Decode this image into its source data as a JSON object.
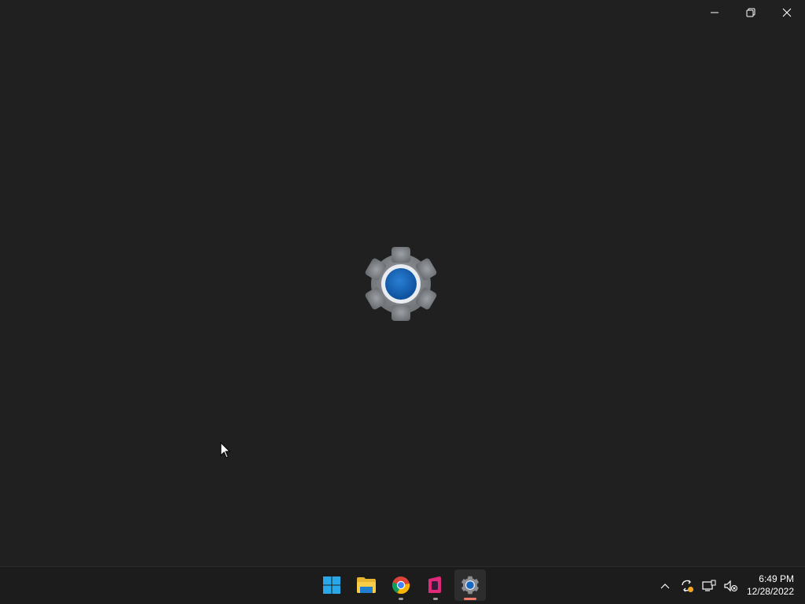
{
  "window": {
    "controls": {
      "minimize_icon": "minimize-icon",
      "restore_icon": "restore-icon",
      "close_icon": "close-icon"
    },
    "splash_icon": "settings-gear-icon"
  },
  "taskbar": {
    "apps": [
      {
        "name": "Start",
        "icon": "windows-start-icon",
        "running": false,
        "active": false
      },
      {
        "name": "File Explorer",
        "icon": "folder-icon",
        "running": false,
        "active": false
      },
      {
        "name": "Google Chrome",
        "icon": "chrome-icon",
        "running": true,
        "active": false
      },
      {
        "name": "App",
        "icon": "pink-app-icon",
        "running": true,
        "active": false
      },
      {
        "name": "Settings",
        "icon": "settings-gear-icon",
        "running": true,
        "active": true
      }
    ],
    "tray": {
      "icons": [
        "chevron-up-icon",
        "sync-alert-icon",
        "network-icon",
        "volume-muted-icon"
      ]
    },
    "clock": {
      "time": "6:49 PM",
      "date": "12/28/2022"
    }
  },
  "colors": {
    "background": "#202020",
    "taskbar": "#1c1c1c",
    "accent_indicator": "#f07a6a",
    "gear_gray": "#7c7f84",
    "gear_center": "#1565c0"
  }
}
